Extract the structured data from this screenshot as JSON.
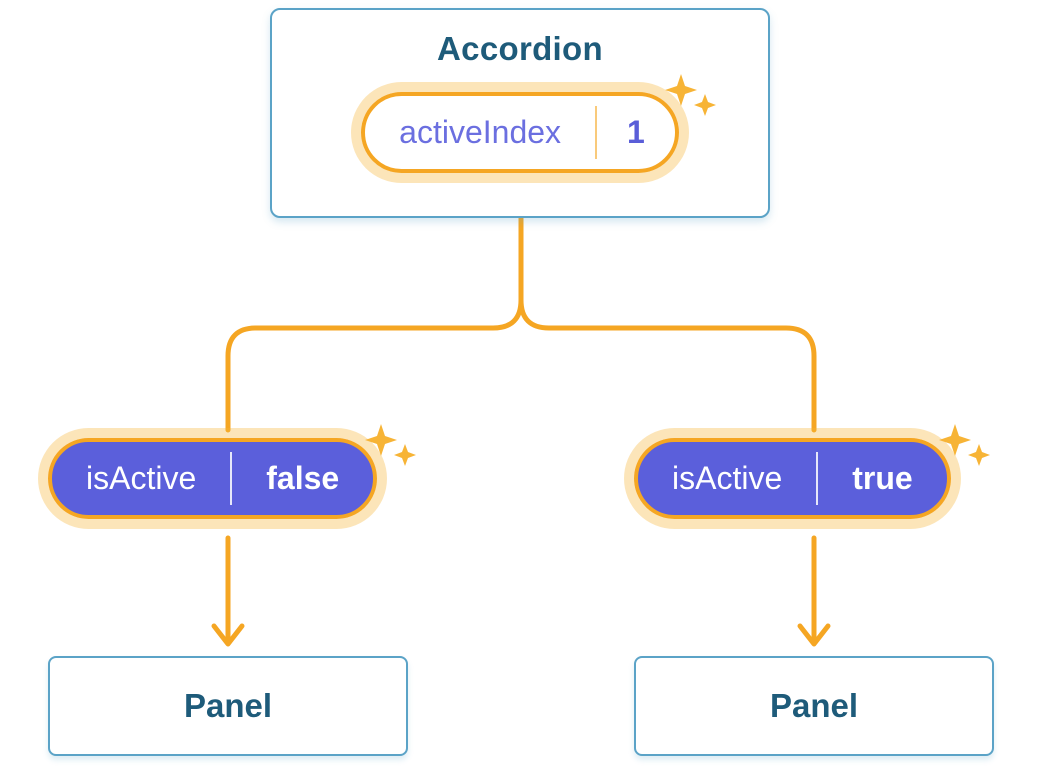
{
  "accordion": {
    "title": "Accordion",
    "state": {
      "key": "activeIndex",
      "value": "1"
    }
  },
  "children": [
    {
      "propKey": "isActive",
      "propValue": "false",
      "label": "Panel"
    },
    {
      "propKey": "isActive",
      "propValue": "true",
      "label": "Panel"
    }
  ],
  "colors": {
    "orange": "#F5A623"
  }
}
